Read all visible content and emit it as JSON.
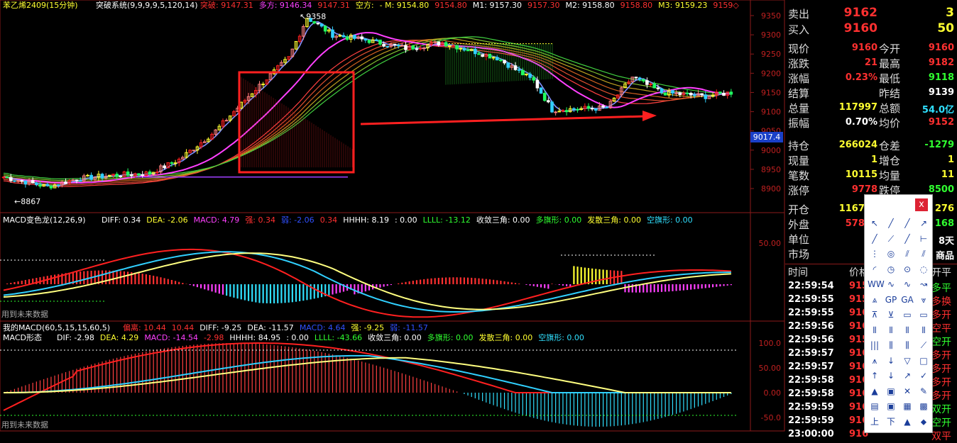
{
  "main_header": {
    "symbol": "苯乙烯2409(15分钟)",
    "system_name": "突破系统(9,9,9,9,5,120,14)",
    "items": [
      {
        "label": "突破:",
        "value": "9147.31",
        "color": "#ff3030"
      },
      {
        "label": "多方:",
        "value": "9146.34",
        "color": "#ff40ff"
      },
      {
        "label": "",
        "value": "9147.31",
        "color": "#ff3030"
      },
      {
        "label": "空方:",
        "value": "",
        "color": "#ffff30"
      },
      {
        "label": "- M:",
        "value": "9154.80",
        "color": "#ffff30"
      },
      {
        "label": "",
        "value": "9154.80",
        "color": "#ff3030"
      },
      {
        "label": "M1:",
        "value": "9157.30",
        "color": "#ffffff"
      },
      {
        "label": "",
        "value": "9157.30",
        "color": "#ff3030"
      },
      {
        "label": "M2:",
        "value": "9158.80",
        "color": "#ffffff"
      },
      {
        "label": "",
        "value": "9158.80",
        "color": "#ff3030"
      },
      {
        "label": "M3:",
        "value": "9159.23",
        "color": "#ffff30"
      },
      {
        "label": "",
        "value": "9159◇",
        "color": "#ff3030"
      }
    ]
  },
  "price_axis": {
    "ticks": [
      "9350",
      "9300",
      "9250",
      "9200",
      "9150",
      "9100",
      "9050",
      "9000",
      "8950",
      "8900"
    ],
    "current_tag": "9017.4"
  },
  "chart_annotations": {
    "high": "9358",
    "low": "8867"
  },
  "macd1": {
    "title": "MACD变色龙(12,26,9)",
    "items": [
      {
        "label": "DIFF:",
        "value": "0.34",
        "color": "#ffffff"
      },
      {
        "label": "DEA:",
        "value": "-2.06",
        "color": "#ffff30"
      },
      {
        "label": "MACD:",
        "value": "4.79",
        "color": "#ff40ff"
      },
      {
        "label": "强:",
        "value": "0.34",
        "color": "#ff3030"
      },
      {
        "label": "弱:",
        "value": "-2.06",
        "color": "#3050ff"
      },
      {
        "label": "",
        "value": "0.34",
        "color": "#ff3030"
      },
      {
        "label": "HHHH:",
        "value": "8.19",
        "color": "#ffffff"
      },
      {
        "label": ":",
        "value": "0.00",
        "color": "#ffffff"
      },
      {
        "label": "LLLL:",
        "value": "-13.12",
        "color": "#30ff30"
      },
      {
        "label": "收敛三角:",
        "value": "0.00",
        "color": "#ffffff"
      },
      {
        "label": "多旗形:",
        "value": "0.00",
        "color": "#30ff30"
      },
      {
        "label": "发散三角:",
        "value": "0.00",
        "color": "#ffff30"
      },
      {
        "label": "空旗形:",
        "value": "0.00",
        "color": "#30e0ff"
      }
    ],
    "axis_tick": "50.00",
    "footer": "用到未来数据"
  },
  "macd2": {
    "title": "我的MACD(60,5,15,15,60,5)",
    "title2": "MACD形态",
    "items": [
      {
        "label": "偏离:",
        "value": "10.44",
        "color": "#ff3030"
      },
      {
        "label": "",
        "value": "10.44",
        "color": "#ff3030"
      },
      {
        "label": "DIFF:",
        "value": "-9.25",
        "color": "#ffffff"
      },
      {
        "label": "DEA:",
        "value": "-11.57",
        "color": "#ffffff"
      },
      {
        "label": "MACD:",
        "value": "4.64",
        "color": "#3050ff"
      },
      {
        "label": "强:",
        "value": "-9.25",
        "color": "#ffff30"
      },
      {
        "label": "弱:",
        "value": "-11.57",
        "color": "#3050ff"
      }
    ],
    "items2": [
      {
        "label": "DIF:",
        "value": "-2.98",
        "color": "#ffffff"
      },
      {
        "label": "DEA:",
        "value": "4.29",
        "color": "#ffff30"
      },
      {
        "label": "MACD:",
        "value": "-14.54",
        "color": "#ff40ff"
      },
      {
        "label": "",
        "value": "-2.98",
        "color": "#ff3030"
      },
      {
        "label": "HHHH:",
        "value": "84.95",
        "color": "#ffffff"
      },
      {
        "label": ":",
        "value": "0.00",
        "color": "#ffffff"
      },
      {
        "label": "LLLL:",
        "value": "-43.66",
        "color": "#30ff30"
      },
      {
        "label": "收敛三角:",
        "value": "0.00",
        "color": "#ffffff"
      },
      {
        "label": "多旗形:",
        "value": "0.00",
        "color": "#30ff30"
      },
      {
        "label": "发散三角:",
        "value": "0.00",
        "color": "#ffff30"
      },
      {
        "label": "空旗形:",
        "value": "0.00",
        "color": "#30e0ff"
      }
    ],
    "axis_ticks": [
      "100.0",
      "50.00",
      "0.00",
      "-50.0"
    ],
    "footer": "用到未来数据"
  },
  "quote": {
    "sell_label": "卖出",
    "sell_price": "9162",
    "sell_vol": "3",
    "buy_label": "买入",
    "buy_price": "9160",
    "buy_vol": "50",
    "rows": [
      {
        "l1": "现价",
        "v1": "9160",
        "c1": "#ff3030",
        "l2": "今开",
        "v2": "9160",
        "c2": "#ff3030"
      },
      {
        "l1": "涨跌",
        "v1": "21",
        "c1": "#ff3030",
        "l2": "最高",
        "v2": "9182",
        "c2": "#ff3030"
      },
      {
        "l1": "涨幅",
        "v1": "0.23%",
        "c1": "#ff3030",
        "l2": "最低",
        "v2": "9118",
        "c2": "#30ff30"
      },
      {
        "l1": "结算",
        "v1": "",
        "c1": "#ffffff",
        "l2": "昨结",
        "v2": "9139",
        "c2": "#ffffff"
      },
      {
        "l1": "总量",
        "v1": "117997",
        "c1": "#ffff30",
        "l2": "总额",
        "v2": "54.0亿",
        "c2": "#30e0ff"
      },
      {
        "l1": "振幅",
        "v1": "0.70%",
        "c1": "#ffffff",
        "l2": "均价",
        "v2": "9152",
        "c2": "#ff3030"
      },
      {
        "l1": "持仓",
        "v1": "266024",
        "c1": "#ffff30",
        "l2": "仓差",
        "v2": "-1279",
        "c2": "#30ff30"
      },
      {
        "l1": "现量",
        "v1": "1",
        "c1": "#ffff30",
        "l2": "增仓",
        "v2": "1",
        "c2": "#ffff30"
      },
      {
        "l1": "笔数",
        "v1": "10115",
        "c1": "#ffff30",
        "l2": "均量",
        "v2": "11",
        "c2": "#ffff30"
      },
      {
        "l1": "涨停",
        "v1": "9778",
        "c1": "#ff3030",
        "l2": "跌停",
        "v2": "8500",
        "c2": "#30ff30"
      },
      {
        "l1": "开仓",
        "v1": "116718",
        "c1": "#ffff30",
        "l2": "",
        "v2": "276",
        "c2": "#ffff30"
      },
      {
        "l1": "外盘",
        "v1": "57829",
        "c1": "#ff3030",
        "l2": "",
        "v2": "168",
        "c2": "#30ff30"
      },
      {
        "l1": "单位",
        "v1": "",
        "c1": "#ffffff",
        "l2": "每",
        "v2": "8天",
        "c2": "#ffffff"
      },
      {
        "l1": "市场",
        "v1": "",
        "c1": "#ffffff",
        "l2": "",
        "v2": "商品",
        "c2": "#ffffff"
      }
    ],
    "tick_header": {
      "time": "时间",
      "price": "价格",
      "type": "开平"
    },
    "ticks": [
      {
        "time": "22:59:54",
        "price": "915",
        "type": "多平",
        "color": "#30ff30"
      },
      {
        "time": "22:59:55",
        "price": "915",
        "type": "多换",
        "color": "#ff3030"
      },
      {
        "time": "22:59:55",
        "price": "916",
        "type": "多开",
        "color": "#ff3030"
      },
      {
        "time": "22:59:56",
        "price": "916",
        "type": "空平",
        "color": "#ff3030"
      },
      {
        "time": "22:59:56",
        "price": "915",
        "type": "空开",
        "color": "#30ff30"
      },
      {
        "time": "22:59:57",
        "price": "916",
        "type": "多开",
        "color": "#ff3030"
      },
      {
        "time": "22:59:57",
        "price": "916",
        "type": "多开",
        "color": "#ff3030"
      },
      {
        "time": "22:59:58",
        "price": "916",
        "type": "多开",
        "color": "#ff3030"
      },
      {
        "time": "22:59:58",
        "price": "916",
        "type": "多开",
        "color": "#ff3030"
      },
      {
        "time": "22:59:59",
        "price": "916",
        "type": "双开",
        "color": "#30ff30"
      },
      {
        "time": "22:59:59",
        "price": "916",
        "type": "空开",
        "color": "#30ff30"
      },
      {
        "time": "23:00:00",
        "price": "916",
        "type": "双平",
        "color": "#ff3030"
      }
    ]
  },
  "toolbar": {
    "close": "x",
    "tools": [
      "↖",
      "╱",
      "╱",
      "↗",
      "╱",
      "⟋",
      "╱",
      "⊢",
      "⋮",
      "◎",
      "⫽",
      "⫽",
      "◜",
      "◷",
      "⊙",
      "◌",
      "WW",
      "∿",
      "∿",
      "↝",
      "⩓",
      "GP",
      "GA",
      "⩔",
      "⊼",
      "⊻",
      "▭",
      "▭",
      "⫴",
      "⫴",
      "⫴",
      "⫴",
      "|||",
      "⫼",
      "⫼",
      "⟋",
      "⩚",
      "↓",
      "▽",
      "□",
      "↑",
      "↓",
      "↗",
      "✓",
      "▲",
      "▣",
      "✕",
      "✎",
      "▤",
      "▣",
      "▦",
      "▩",
      "上",
      "下",
      "▲",
      "⬥"
    ]
  }
}
